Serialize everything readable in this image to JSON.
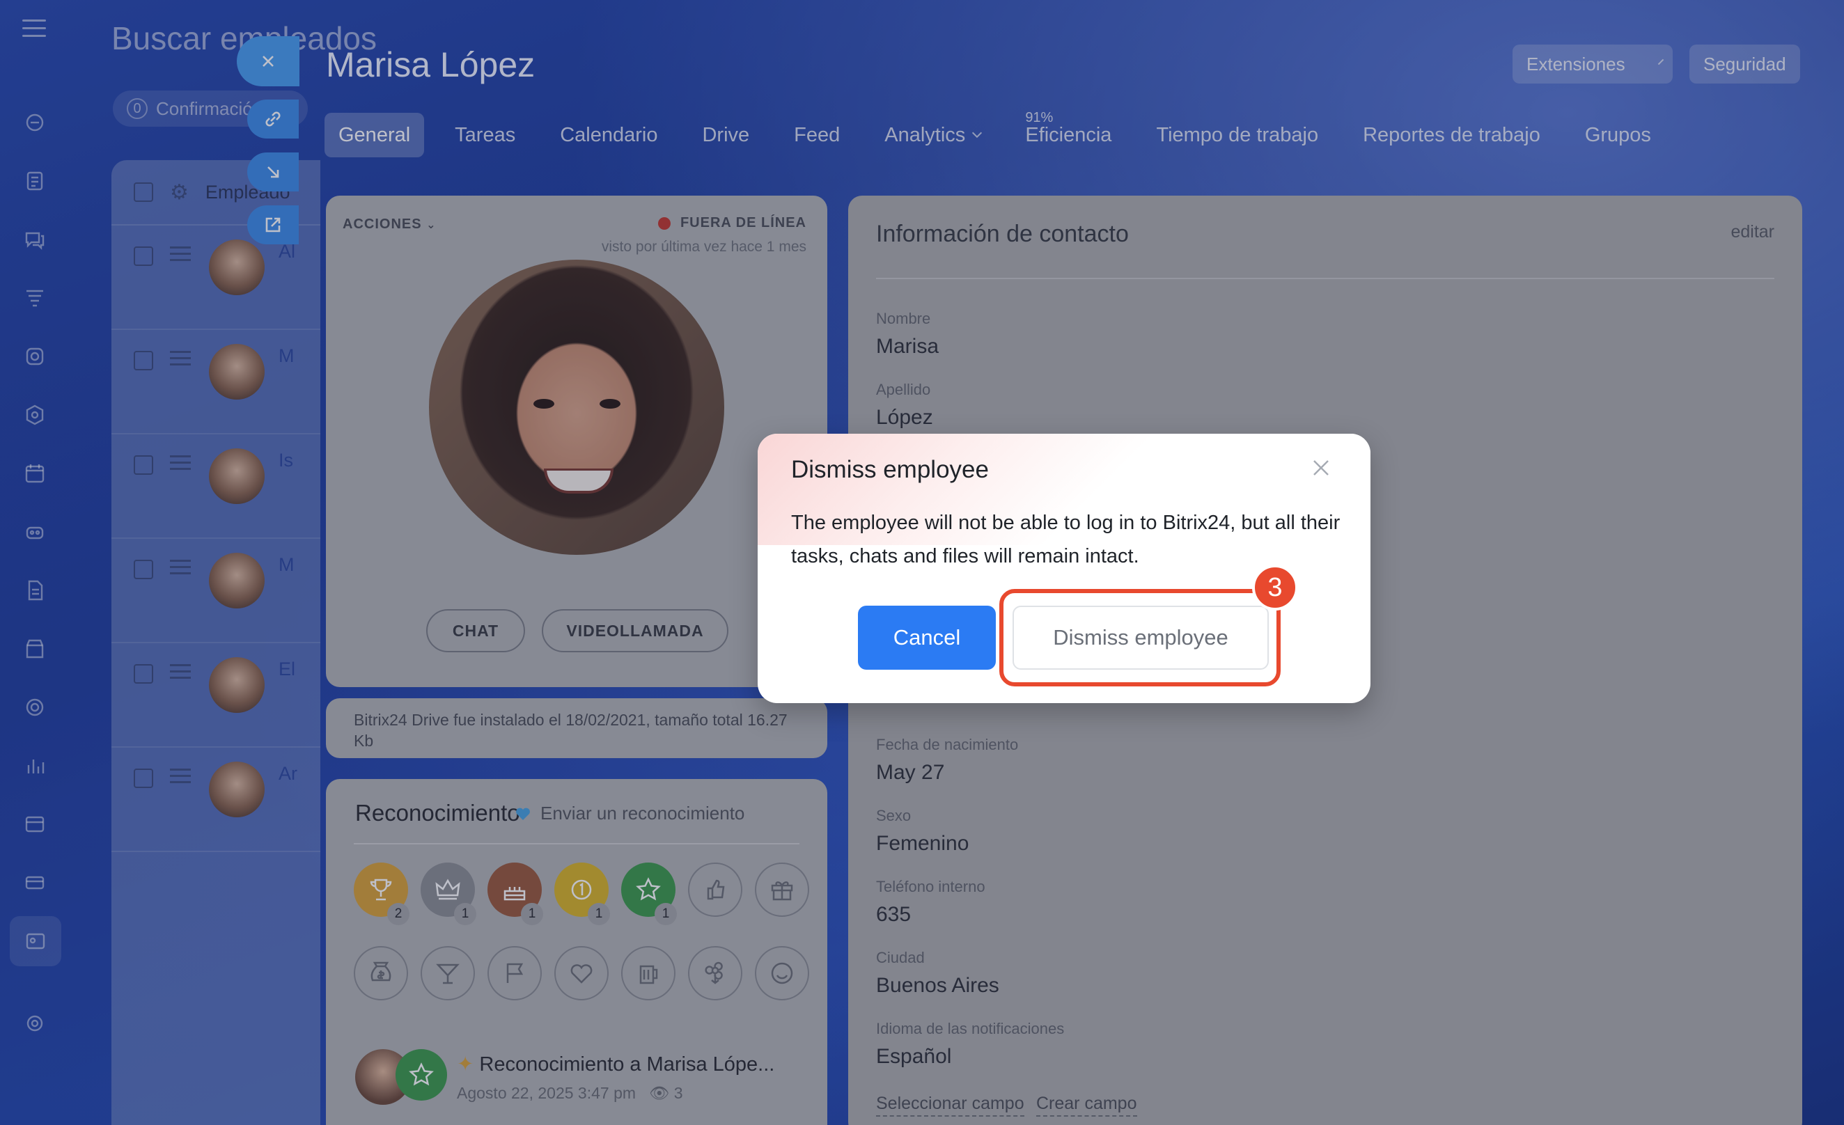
{
  "underlying": {
    "title": "Buscar empleados",
    "filter_count": "0",
    "filter_label": "Confirmación",
    "column_header": "Empleado",
    "rows": [
      {
        "name": "Al"
      },
      {
        "name": "M"
      },
      {
        "name": "Is"
      },
      {
        "name": "M"
      },
      {
        "name": "El"
      },
      {
        "name": "Ar"
      }
    ]
  },
  "profile": {
    "name": "Marisa López",
    "extensions_label": "Extensiones",
    "security_label": "Seguridad",
    "tabs": [
      {
        "label": "General"
      },
      {
        "label": "Tareas"
      },
      {
        "label": "Calendario"
      },
      {
        "label": "Drive"
      },
      {
        "label": "Feed"
      },
      {
        "label": "Analytics"
      },
      {
        "label": "Eficiencia",
        "sup": "91%"
      },
      {
        "label": "Tiempo de trabajo"
      },
      {
        "label": "Reportes de trabajo"
      },
      {
        "label": "Grupos"
      }
    ],
    "actions_label": "ACCIONES",
    "status_label": "FUERA DE LÍNEA",
    "last_seen": "visto por última vez hace 1 mes",
    "chat_label": "CHAT",
    "video_label": "VIDEOLLAMADA",
    "drive_note": "Bitrix24 Drive fue instalado el 18/02/2021, tamaño total 16.27 Kb",
    "recognition": {
      "title": "Reconocimiento",
      "send_label": "Enviar un reconocimiento",
      "badges": [
        {
          "icon": "trophy-icon",
          "color": "#d9a23a",
          "count": "2"
        },
        {
          "icon": "crown-icon",
          "color": "#8d8f94",
          "count": "1"
        },
        {
          "icon": "cake-icon",
          "color": "#9a5a3e",
          "count": "1"
        },
        {
          "icon": "coin-icon",
          "color": "#d8b52a",
          "count": "1"
        },
        {
          "icon": "star-icon",
          "color": "#3f9a4d",
          "count": "1"
        },
        {
          "icon": "thumbs-up-icon",
          "color": "",
          "count": ""
        },
        {
          "icon": "gift-icon",
          "color": "",
          "count": ""
        },
        {
          "icon": "money-bag-icon",
          "color": "",
          "count": ""
        },
        {
          "icon": "cocktail-icon",
          "color": "",
          "count": ""
        },
        {
          "icon": "flag-icon",
          "color": "",
          "count": ""
        },
        {
          "icon": "heart-icon",
          "color": "",
          "count": ""
        },
        {
          "icon": "beer-icon",
          "color": "",
          "count": ""
        },
        {
          "icon": "flower-icon",
          "color": "",
          "count": ""
        },
        {
          "icon": "smile-icon",
          "color": "",
          "count": ""
        }
      ],
      "feed_title": "Reconocimiento a Marisa Lópe...",
      "feed_date": "Agosto 22, 2025 3:47 pm",
      "feed_views": "3"
    },
    "contact": {
      "title": "Información de contacto",
      "edit_label": "editar",
      "fields": [
        {
          "label": "Nombre",
          "value": "Marisa"
        },
        {
          "label": "Apellido",
          "value": "López"
        },
        {
          "label": "Fecha de nacimiento",
          "value": "May 27"
        },
        {
          "label": "Sexo",
          "value": "Femenino"
        },
        {
          "label": "Teléfono interno",
          "value": "635"
        },
        {
          "label": "Ciudad",
          "value": "Buenos Aires"
        },
        {
          "label": "Idioma de las notificaciones",
          "value": "Español"
        }
      ],
      "select_field_label": "Seleccionar campo",
      "create_field_label": "Crear campo"
    }
  },
  "modal": {
    "title": "Dismiss employee",
    "text": "The employee will not be able to log in to Bitrix24, but all their tasks, chats and files will remain intact.",
    "cancel_label": "Cancel",
    "dismiss_label": "Dismiss employee",
    "step_number": "3",
    "accent_color": "#e8492e",
    "primary_color": "#2b7bf3"
  }
}
